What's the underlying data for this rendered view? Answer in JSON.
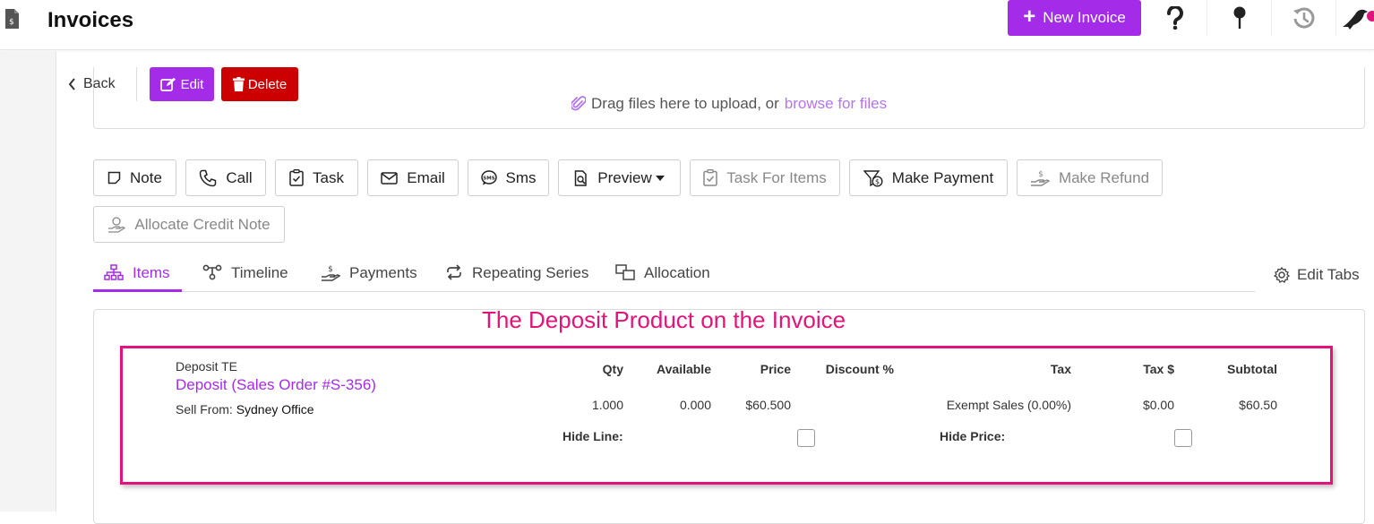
{
  "header": {
    "title": "Invoices",
    "new_invoice_label": "New Invoice"
  },
  "actions": {
    "back_label": "Back",
    "edit_label": "Edit",
    "delete_label": "Delete"
  },
  "dropzone": {
    "text": "Drag files here to upload, or",
    "browse_label": "browse for files"
  },
  "activity_buttons": {
    "note": "Note",
    "call": "Call",
    "task": "Task",
    "email": "Email",
    "sms": "Sms",
    "preview": "Preview",
    "task_for_items": "Task For Items",
    "make_payment": "Make Payment",
    "make_refund": "Make Refund",
    "allocate_credit_note": "Allocate Credit Note"
  },
  "tabs": {
    "items": "Items",
    "timeline": "Timeline",
    "payments": "Payments",
    "repeating_series": "Repeating Series",
    "allocation": "Allocation",
    "edit_tabs": "Edit Tabs"
  },
  "annotation": "The Deposit Product on the Invoice",
  "line_item": {
    "sku": "Deposit TE",
    "name": "Deposit (Sales Order #S-356)",
    "sell_from_label": "Sell From:",
    "sell_from_value": "Sydney Office",
    "columns": {
      "qty": "Qty",
      "available": "Available",
      "price": "Price",
      "discount": "Discount %",
      "tax": "Tax",
      "tax_amount": "Tax $",
      "subtotal": "Subtotal"
    },
    "values": {
      "qty": "1.000",
      "available": "0.000",
      "price": "$60.500",
      "tax": "Exempt Sales (0.00%)",
      "tax_amount": "$0.00",
      "subtotal": "$60.50"
    },
    "hide_line_label": "Hide Line:",
    "hide_price_label": "Hide Price:"
  },
  "colors": {
    "accent": "#a42be8",
    "danger": "#cc0000",
    "annotation": "#e0147a"
  }
}
